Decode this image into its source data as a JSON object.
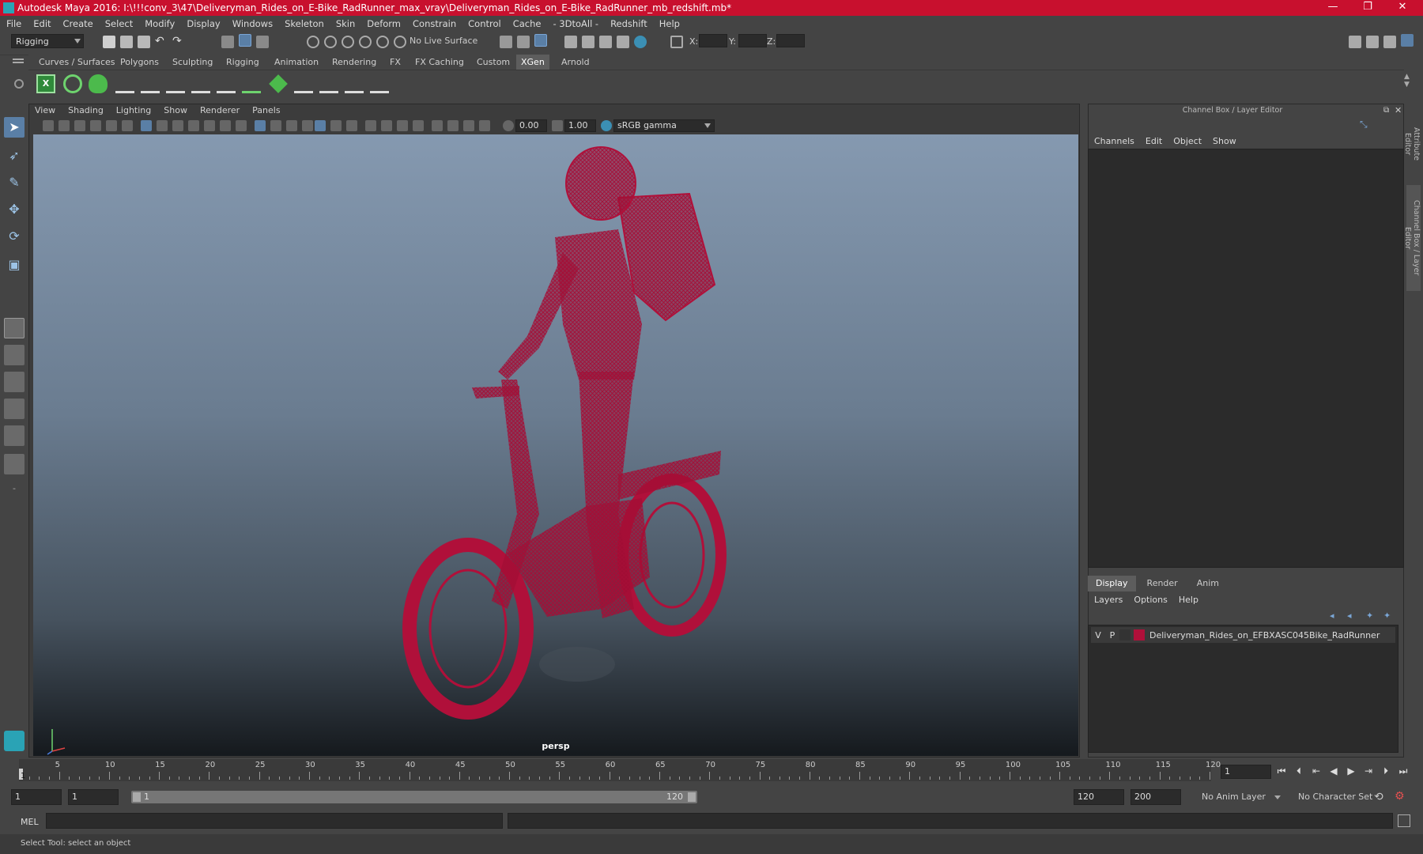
{
  "window": {
    "title": "Autodesk Maya 2016: I:\\!!!conv_3\\47\\Deliveryman_Rides_on_E-Bike_RadRunner_max_vray\\Deliveryman_Rides_on_E-Bike_RadRunner_mb_redshift.mb*",
    "minimize": "—",
    "maximize": "❐",
    "close": "✕"
  },
  "menubar": [
    "File",
    "Edit",
    "Create",
    "Select",
    "Modify",
    "Display",
    "Windows",
    "Skeleton",
    "Skin",
    "Deform",
    "Constrain",
    "Control",
    "Cache",
    "- 3DtoAll -",
    "Redshift",
    "Help"
  ],
  "statusline": {
    "mode": "Rigging",
    "live_surface": "No Live Surface",
    "x_label": "X:",
    "y_label": "Y:",
    "z_label": "Z:"
  },
  "shelf_tabs": [
    "Curves / Surfaces",
    "Polygons",
    "Sculpting",
    "Rigging",
    "Animation",
    "Rendering",
    "FX",
    "FX Caching",
    "Custom",
    "XGen",
    "Arnold"
  ],
  "active_shelf": "XGen",
  "viewport": {
    "menu": [
      "View",
      "Shading",
      "Lighting",
      "Show",
      "Renderer",
      "Panels"
    ],
    "exposure": "0.00",
    "gamma": "1.00",
    "color_space": "sRGB gamma",
    "camera": "persp",
    "wire_color": "#b0103a"
  },
  "channel_box": {
    "title": "Channel Box / Layer Editor",
    "menu": [
      "Channels",
      "Edit",
      "Object",
      "Show"
    ]
  },
  "layer_editor": {
    "tabs": [
      "Display",
      "Render",
      "Anim"
    ],
    "active_tab": "Display",
    "menu": [
      "Layers",
      "Options",
      "Help"
    ],
    "layers": [
      {
        "v": "V",
        "p": "P",
        "color": "#b0103a",
        "name": "Deliveryman_Rides_on_EFBXASC045Bike_RadRunner"
      }
    ]
  },
  "side_tabs": [
    "Attribute Editor",
    "Channel Box / Layer Editor"
  ],
  "timeline": {
    "ticks": [
      "5",
      "10",
      "15",
      "20",
      "25",
      "30",
      "35",
      "40",
      "45",
      "50",
      "55",
      "60",
      "65",
      "70",
      "75",
      "80",
      "85",
      "90",
      "95",
      "100",
      "105",
      "110",
      "115",
      "120"
    ],
    "current_frame": "1",
    "start_marker": "1"
  },
  "range": {
    "start": "1",
    "playback_start": "1",
    "slider_start": "1",
    "slider_end": "120",
    "playback_end": "120",
    "end": "200",
    "anim_layer": "No Anim Layer",
    "character_set": "No Character Set"
  },
  "command_line": {
    "language": "MEL"
  },
  "help_line": "Select Tool: select an object"
}
